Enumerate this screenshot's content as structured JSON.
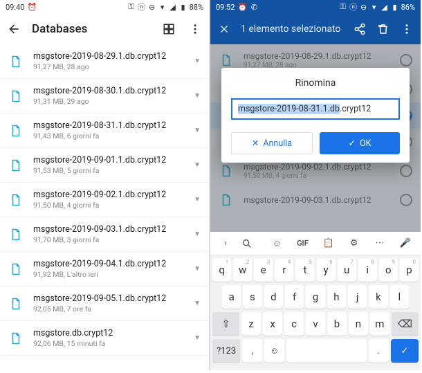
{
  "left": {
    "status": {
      "time": "09:40",
      "battery": "88%"
    },
    "title": "Databases",
    "files": [
      {
        "name": "msgstore-2019-08-29.1.db.crypt12",
        "meta": "91,27 MB, 28 ago"
      },
      {
        "name": "msgstore-2019-08-30.1.db.crypt12",
        "meta": "91,31 MB, 29 ago"
      },
      {
        "name": "msgstore-2019-08-31.1.db.crypt12",
        "meta": "91,43 MB, 6 giorni fa"
      },
      {
        "name": "msgstore-2019-09-01.1.db.crypt12",
        "meta": "91,53 MB, 5 giorni fa"
      },
      {
        "name": "msgstore-2019-09-02.1.db.crypt12",
        "meta": "91,50 MB, 4 giorni fa"
      },
      {
        "name": "msgstore-2019-09-03.1.db.crypt12",
        "meta": "91,70 MB, 3 giorni fa"
      },
      {
        "name": "msgstore-2019-09-04.1.db.crypt12",
        "meta": "91,92 MB, L'altro ieri"
      },
      {
        "name": "msgstore-2019-09-05.1.db.crypt12",
        "meta": "92,05 MB, 7 ore fa"
      },
      {
        "name": "msgstore.db.crypt12",
        "meta": "92,06 MB, 15 minuti fa"
      }
    ]
  },
  "right": {
    "status": {
      "time": "09:52",
      "battery": "86%"
    },
    "selection_title": "1 elemento selezionato",
    "bgfiles": [
      {
        "name": "msgstore-2019-08-29.1.db.crypt12",
        "meta": "91,27 MB, 28 ago",
        "selected": false
      },
      {
        "name": "",
        "meta": "",
        "selected": false
      },
      {
        "name": "",
        "meta": "",
        "selected": true
      },
      {
        "name": "",
        "meta": "",
        "selected": false
      },
      {
        "name": "msgstore-2019-09-02.1.db.crypt12",
        "meta": "91,50 MB, 4 giorni fa",
        "selected": false
      },
      {
        "name": "msgstore-2019-09-03.1.db.crypt12",
        "meta": "",
        "selected": false
      }
    ],
    "dialog": {
      "title": "Rinomina",
      "value_selected": "msgstore-2019-08-31.1.db",
      "value_rest": ".crypt12",
      "cancel": "Annulla",
      "ok": "OK"
    },
    "keyboard": {
      "toolbar": {
        "gif": "GIF"
      },
      "row1": [
        "q",
        "w",
        "e",
        "r",
        "t",
        "y",
        "u",
        "i",
        "o",
        "p"
      ],
      "hints1": [
        "1",
        "2",
        "3",
        "4",
        "5",
        "6",
        "7",
        "8",
        "9",
        "0"
      ],
      "row2": [
        "a",
        "s",
        "d",
        "f",
        "g",
        "h",
        "j",
        "k",
        "l"
      ],
      "row3": [
        "z",
        "x",
        "c",
        "v",
        "b",
        "n",
        "m"
      ],
      "bottom": {
        "symbols": "?123",
        "comma": ",",
        "period": "."
      }
    }
  }
}
